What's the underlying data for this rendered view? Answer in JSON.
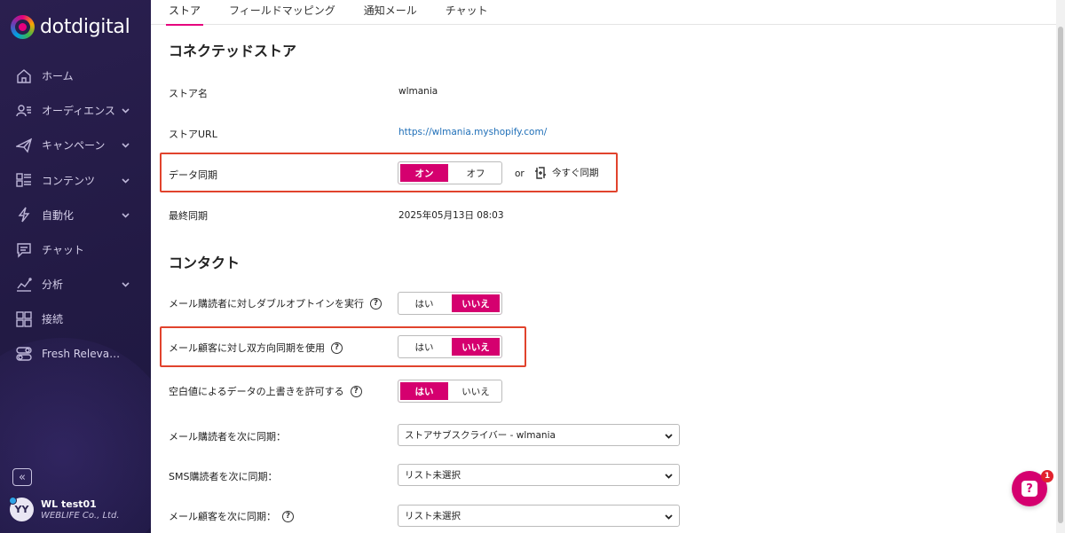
{
  "brand": {
    "name": "dotdigital"
  },
  "sidebar": {
    "items": [
      {
        "label": "ホーム",
        "icon": "home-icon",
        "expandable": false
      },
      {
        "label": "オーディエンス",
        "icon": "audience-icon",
        "expandable": true
      },
      {
        "label": "キャンペーン",
        "icon": "campaign-icon",
        "expandable": true
      },
      {
        "label": "コンテンツ",
        "icon": "content-icon",
        "expandable": true
      },
      {
        "label": "自動化",
        "icon": "automation-icon",
        "expandable": true
      },
      {
        "label": "チャット",
        "icon": "chat-icon",
        "expandable": false
      },
      {
        "label": "分析",
        "icon": "analytics-icon",
        "expandable": true
      },
      {
        "label": "接続",
        "icon": "connect-icon",
        "expandable": false
      },
      {
        "label": "Fresh Releva…",
        "icon": "toggles-icon",
        "expandable": false
      }
    ],
    "collapse_icon": "double-chevron-left-icon"
  },
  "user": {
    "initials": "YY",
    "name": "WL test01",
    "company": "WEBLIFE Co., Ltd."
  },
  "tabs": [
    {
      "label": "ストア",
      "active": true
    },
    {
      "label": "フィールドマッピング",
      "active": false
    },
    {
      "label": "通知メール",
      "active": false
    },
    {
      "label": "チャット",
      "active": false
    }
  ],
  "connected_store": {
    "title": "コネクテッドストア",
    "store_name_label": "ストア名",
    "store_name": "wlmania",
    "store_url_label": "ストアURL",
    "store_url": "https://wlmania.myshopify.com/",
    "data_sync_label": "データ同期",
    "data_sync_on": "オン",
    "data_sync_off": "オフ",
    "data_sync_selected": "on",
    "or_text": "or",
    "sync_now_label": "今すぐ同期",
    "last_sync_label": "最終同期",
    "last_sync": "2025年05月13日 08:03"
  },
  "contacts": {
    "title": "コンタクト",
    "double_optin_label": "メール購読者に対しダブルオプトインを実行",
    "double_optin_yes": "はい",
    "double_optin_no": "いいえ",
    "double_optin_selected": "no",
    "two_way_sync_label": "メール顧客に対し双方向同期を使用",
    "two_way_sync_yes": "はい",
    "two_way_sync_no": "いいえ",
    "two_way_sync_selected": "no",
    "allow_blank_overwrite_label": "空白値によるデータの上書きを許可する",
    "allow_blank_yes": "はい",
    "allow_blank_no": "いいえ",
    "allow_blank_selected": "yes",
    "email_subscribers_sync_label": "メール購読者を次に同期：",
    "email_subscribers_sync_value": "ストアサブスクライバー - wlmania",
    "sms_subscribers_sync_label": "SMS購読者を次に同期：",
    "sms_subscribers_sync_value": "リスト未選択",
    "email_customers_sync_label": "メール顧客を次に同期：",
    "email_customers_sync_value": "リスト未選択",
    "help_glyph": "?"
  },
  "chat_widget": {
    "badge_count": "1",
    "glyph": "?"
  },
  "colors": {
    "accent": "#d5006f",
    "highlight": "#e1432d",
    "link": "#1f6fb8",
    "sidebar_bg": "#241c47"
  }
}
